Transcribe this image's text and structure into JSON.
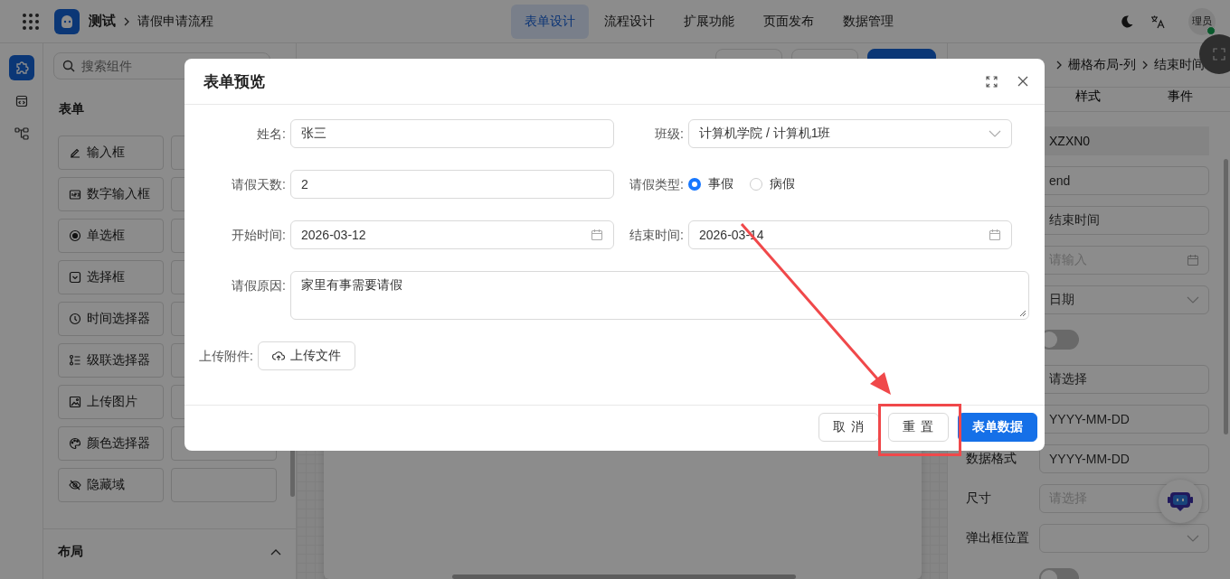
{
  "header": {
    "app_name": "测试",
    "breadcrumb": "请假申请流程",
    "tabs": [
      {
        "label": "表单设计",
        "selected": true
      },
      {
        "label": "流程设计",
        "selected": false
      },
      {
        "label": "扩展功能",
        "selected": false
      },
      {
        "label": "页面发布",
        "selected": false
      },
      {
        "label": "数据管理",
        "selected": false
      }
    ],
    "avatar": "理员"
  },
  "left_panel": {
    "search": {
      "placeholder": "搜索组件"
    },
    "section_title": "表单",
    "components": [
      {
        "label": "输入框",
        "kind": "input"
      },
      {
        "label": "数字输入框",
        "kind": "number"
      },
      {
        "label": "单选框",
        "kind": "radio"
      },
      {
        "label": "选择框",
        "kind": "select"
      },
      {
        "label": "时间选择器",
        "kind": "time"
      },
      {
        "label": "级联选择器",
        "kind": "cascader"
      },
      {
        "label": "上传图片",
        "kind": "image"
      },
      {
        "label": "颜色选择器",
        "kind": "color"
      },
      {
        "label": "隐藏域",
        "kind": "hidden"
      }
    ],
    "layout_section": {
      "title": "布局",
      "expanded": true
    }
  },
  "right_panel": {
    "breadcrumb": [
      "栅格布局-列",
      "结束时间"
    ],
    "tabs": [
      {
        "label": "样式"
      },
      {
        "label": "事件"
      }
    ],
    "properties": [
      {
        "kind": "readonly",
        "value": "XZXN0"
      },
      {
        "kind": "input",
        "value": "end"
      },
      {
        "kind": "input",
        "value": "结束时间"
      },
      {
        "kind": "date",
        "placeholder": "请输入"
      },
      {
        "kind": "select",
        "value": "日期"
      },
      {
        "kind": "switch",
        "on": false
      },
      {
        "kind": "input",
        "value": "请选择"
      },
      {
        "kind": "input",
        "value": "YYYY-MM-DD"
      },
      {
        "label": "数据格式",
        "kind": "input",
        "value": "YYYY-MM-DD"
      },
      {
        "label": "尺寸",
        "kind": "input",
        "placeholder": "请选择"
      },
      {
        "label": "弹出框位置",
        "kind": "select"
      },
      {
        "kind": "switch",
        "on": false
      }
    ]
  },
  "dialog": {
    "title": "表单预览",
    "fields": [
      {
        "label": "姓名:",
        "kind": "input",
        "value": "张三"
      },
      {
        "label": "班级:",
        "kind": "cascader",
        "value": "计算机学院 / 计算机1班"
      },
      {
        "label": "请假天数:",
        "kind": "input",
        "value": "2"
      },
      {
        "label": "请假类型:",
        "kind": "radio",
        "options": [
          {
            "label": "事假",
            "selected": true
          },
          {
            "label": "病假",
            "selected": false
          }
        ]
      },
      {
        "label": "开始时间:",
        "kind": "date",
        "value": "2026-03-12"
      },
      {
        "label": "结束时间:",
        "kind": "date",
        "value": "2026-03-14"
      },
      {
        "label": "请假原因:",
        "kind": "textarea",
        "value": "家里有事需要请假"
      },
      {
        "label": "上传附件:",
        "kind": "upload",
        "button": "上传文件"
      }
    ],
    "buttons": [
      {
        "label": "取 消",
        "kind": "default"
      },
      {
        "label": "重 置",
        "kind": "default"
      },
      {
        "label": "表单数据",
        "kind": "primary"
      }
    ]
  }
}
